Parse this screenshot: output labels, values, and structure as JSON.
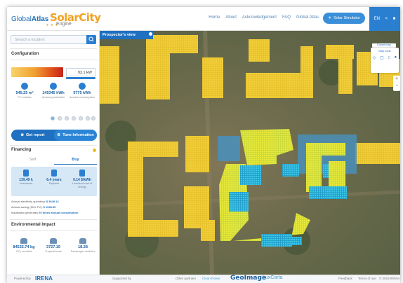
{
  "header": {
    "logo_brand_a": "Global",
    "logo_brand_b": "Atlas",
    "logo_solar": "SolarCity",
    "logo_engine": "Engine",
    "nav": [
      "Home",
      "About",
      "Acknowledgement",
      "FAQ",
      "Global Atlas"
    ],
    "simulator_label": "Solar Simulator",
    "lang": "EN"
  },
  "sidebar": {
    "search_placeholder": "Search a location",
    "configuration_title": "Configuration",
    "kw_value": "93.1 kW",
    "stats": [
      {
        "icon": "solar-panel-icon",
        "value": "545.25 m²",
        "label": "PV surface"
      },
      {
        "icon": "production-icon",
        "value": "145345 kWh",
        "label": "Annual production"
      },
      {
        "icon": "consumption-icon",
        "value": "5775 kWh",
        "label": "Annual consumption"
      }
    ],
    "get_report_label": "Get report",
    "tune_label": "Tune Information",
    "financing_title": "Financing",
    "tabs": [
      "Self",
      "Buy"
    ],
    "selected_tab": "Buy",
    "financing_stats": [
      {
        "icon": "investment-icon",
        "value": "139.49 k",
        "label": "Investment"
      },
      {
        "icon": "payback-icon",
        "value": "6.4 years",
        "label": "Payback"
      },
      {
        "icon": "lcoe-icon",
        "value": "0.14 $/kWh",
        "label": "Levelized cost of energy"
      }
    ],
    "fin_lines": [
      {
        "text": "Annual electricity spending:",
        "value": "$ 3849.13"
      },
      {
        "text": "Annual saving (50% PV):",
        "value": "$ 1948.55"
      },
      {
        "text": "Installation generates",
        "value": "25 times annual consumption"
      }
    ],
    "environment_title": "Environmental Impact",
    "env_stats": [
      {
        "value": "84532.74 kg",
        "label": "CO₂ avoided"
      },
      {
        "value": "3727.19",
        "label": "Tropical trees"
      },
      {
        "value": "18.38",
        "label": "Passenger vehicles"
      }
    ]
  },
  "map": {
    "prospector_label": "Prospector's view",
    "export_label": "Export map",
    "map_tools_label": "Map tools"
  },
  "footer": {
    "powered_by": "Powered by",
    "irena": "IRENA",
    "supported_by": "Supported by",
    "other_partners": "Other partners",
    "clean_power": "Clean Power",
    "geoimage": "GeoImage",
    "luxcarta": "LuxCarta",
    "feedback": "Feedback",
    "terms": "Terms of use",
    "copyright": "© 2019 IRENA"
  },
  "colors": {
    "accent": "#2b7fd1",
    "panel_yellow": "#e6c02a",
    "panel_cyan": "#28b4dc",
    "roof_blue": "#4a8fb8"
  }
}
